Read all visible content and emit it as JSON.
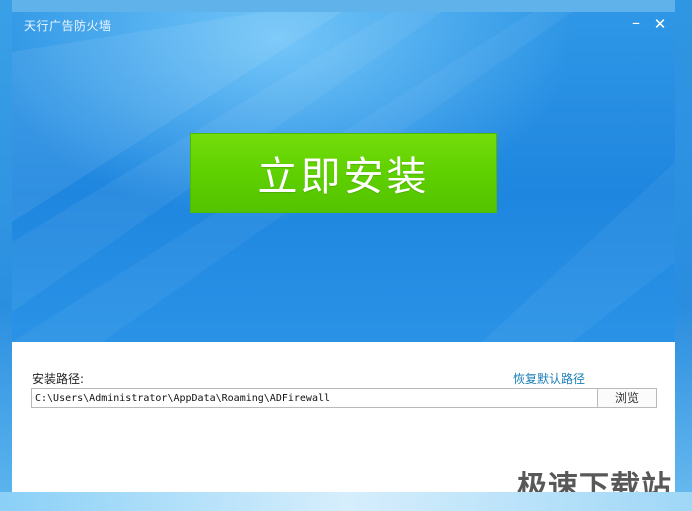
{
  "window": {
    "title": "天行广告防火墙",
    "minimize_glyph": "–",
    "close_glyph": "✕"
  },
  "hero": {
    "install_label": "立即安装"
  },
  "install_path": {
    "label": "安装路径:",
    "restore_default_label": "恢复默认路径",
    "value": "C:\\Users\\Administrator\\AppData\\Roaming\\ADFirewall",
    "browse_label": "浏览"
  },
  "watermark": {
    "text": "极速下载站"
  },
  "colors": {
    "hero_blue": "#1f86df",
    "install_green": "#5fd000",
    "link_color": "#1a7fb8"
  },
  "icons": [
    "minimize-icon",
    "close-icon"
  ]
}
